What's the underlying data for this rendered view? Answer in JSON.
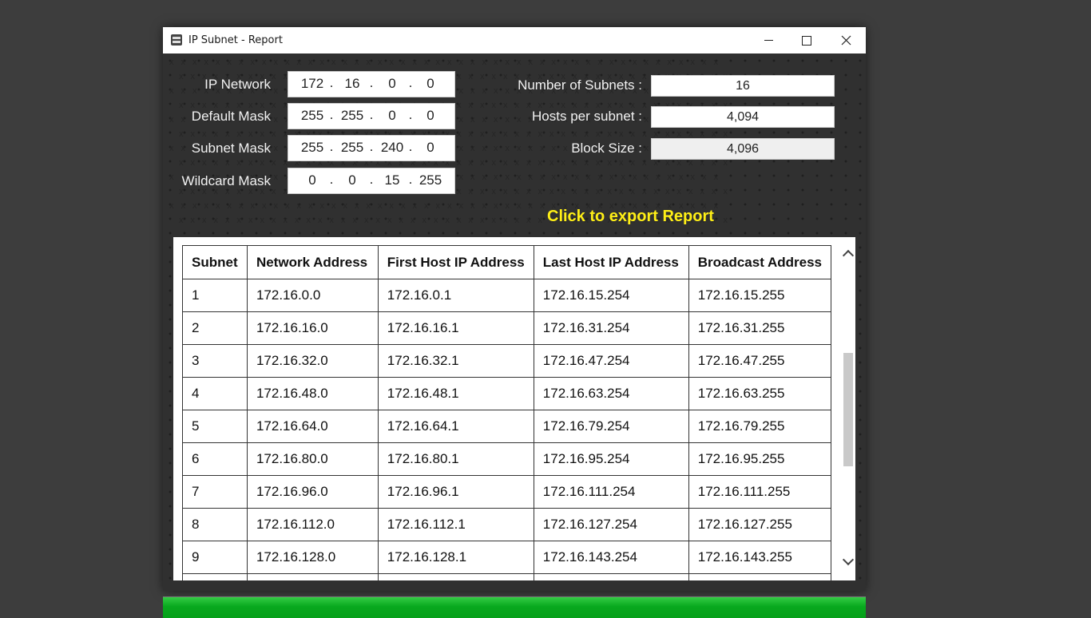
{
  "window": {
    "title": "IP Subnet - Report",
    "controls": [
      "minimize",
      "maximize",
      "close"
    ]
  },
  "form": {
    "ip_network": {
      "label": "IP Network",
      "octets": [
        "172",
        "16",
        "0",
        "0"
      ]
    },
    "default_mask": {
      "label": "Default Mask",
      "octets": [
        "255",
        "255",
        "0",
        "0"
      ]
    },
    "subnet_mask": {
      "label": "Subnet Mask",
      "octets": [
        "255",
        "255",
        "240",
        "0"
      ]
    },
    "wildcard_mask": {
      "label": "Wildcard Mask",
      "octets": [
        "0",
        "0",
        "15",
        "255"
      ]
    },
    "separator": "."
  },
  "stats": {
    "num_subnets": {
      "label": "Number of Subnets :",
      "value": "16"
    },
    "hosts_per_subnet": {
      "label": "Hosts per subnet :",
      "value": "4,094"
    },
    "block_size": {
      "label": "Block Size :",
      "value": "4,096"
    }
  },
  "export": {
    "label": "Click to export Report"
  },
  "table": {
    "headers": [
      "Subnet",
      "Network Address",
      "First Host IP Address",
      "Last Host IP Address",
      "Broadcast Address"
    ],
    "rows": [
      [
        "1",
        "172.16.0.0",
        "172.16.0.1",
        "172.16.15.254",
        "172.16.15.255"
      ],
      [
        "2",
        "172.16.16.0",
        "172.16.16.1",
        "172.16.31.254",
        "172.16.31.255"
      ],
      [
        "3",
        "172.16.32.0",
        "172.16.32.1",
        "172.16.47.254",
        "172.16.47.255"
      ],
      [
        "4",
        "172.16.48.0",
        "172.16.48.1",
        "172.16.63.254",
        "172.16.63.255"
      ],
      [
        "5",
        "172.16.64.0",
        "172.16.64.1",
        "172.16.79.254",
        "172.16.79.255"
      ],
      [
        "6",
        "172.16.80.0",
        "172.16.80.1",
        "172.16.95.254",
        "172.16.95.255"
      ],
      [
        "7",
        "172.16.96.0",
        "172.16.96.1",
        "172.16.111.254",
        "172.16.111.255"
      ],
      [
        "8",
        "172.16.112.0",
        "172.16.112.1",
        "172.16.127.254",
        "172.16.127.255"
      ],
      [
        "9",
        "172.16.128.0",
        "172.16.128.1",
        "172.16.143.254",
        "172.16.143.255"
      ]
    ]
  },
  "progress": {
    "fraction": 1.0
  },
  "colors": {
    "desktop": "#3d3d3d",
    "panel": "#303030",
    "accent_yellow": "#ffef16",
    "progress_green": "#08a81e"
  },
  "icons": [
    "app-icon",
    "minimize-icon",
    "maximize-icon",
    "close-icon",
    "chevron-up-icon",
    "chevron-down-icon"
  ]
}
